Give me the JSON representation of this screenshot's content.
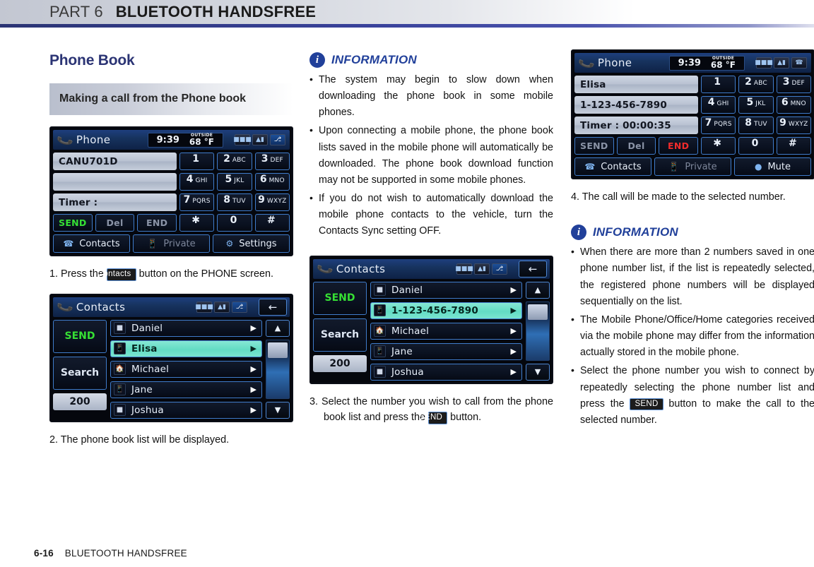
{
  "header": {
    "part": "PART 6",
    "title": "BLUETOOTH HANDSFREE"
  },
  "footer": {
    "page": "6-16",
    "label": "BLUETOOTH HANDSFREE"
  },
  "left": {
    "section_title": "Phone Book",
    "subsection_title": "Making a call from the Phone book",
    "step1_pre": "1. Press the ",
    "step1_chip": "Contacts",
    "step1_post": " button on the PHONE screen.",
    "step2": "2. The phone book list will be displayed.",
    "phone_screen": {
      "title": "Phone",
      "time": "9:39",
      "outside_label": "OUTSIDE",
      "temp": "68 °F",
      "field1": "CANU701D",
      "field2": "",
      "field3": "Timer :",
      "controls": [
        "SEND",
        "Del",
        "END"
      ],
      "keys": [
        {
          "num": "1",
          "abc": ""
        },
        {
          "num": "2",
          "abc": "ABC"
        },
        {
          "num": "3",
          "abc": "DEF"
        },
        {
          "num": "4",
          "abc": "GHI"
        },
        {
          "num": "5",
          "abc": "JKL"
        },
        {
          "num": "6",
          "abc": "MNO"
        },
        {
          "num": "7",
          "abc": "PQRS"
        },
        {
          "num": "8",
          "abc": "TUV"
        },
        {
          "num": "9",
          "abc": "WXYZ"
        },
        {
          "num": "✱",
          "abc": ""
        },
        {
          "num": "0",
          "abc": ""
        },
        {
          "num": "#",
          "abc": ""
        }
      ],
      "foot": [
        "Contacts",
        "Private",
        "Settings"
      ]
    },
    "contacts_screen": {
      "title": "Contacts",
      "send": "SEND",
      "search": "Search",
      "count": "200",
      "rows": [
        {
          "name": "Daniel",
          "icon": "office-icon",
          "selected": false
        },
        {
          "name": "Elisa",
          "icon": "mobile-icon",
          "selected": true
        },
        {
          "name": "Michael",
          "icon": "home-icon",
          "selected": false
        },
        {
          "name": "Jane",
          "icon": "mobile-icon",
          "selected": false
        },
        {
          "name": "Joshua",
          "icon": "office-icon",
          "selected": false
        }
      ]
    }
  },
  "middle": {
    "info_label": "INFORMATION",
    "info_items": [
      "The system may begin to slow down when downloading the phone book in some mobile phones.",
      "Upon connecting a mobile phone, the phone book lists saved in the mobile phone will automatically be downloaded. The phone book download function may not be supported in some mobile phones.",
      "If you do not wish to automatically download the mobile phone contacts to the vehicle, turn the Contacts Sync setting OFF."
    ],
    "step3_pre": "3. Select the number you wish to call from the phone book list and press the ",
    "step3_chip": "SEND",
    "step3_post": " button.",
    "contacts_screen": {
      "title": "Contacts",
      "send": "SEND",
      "search": "Search",
      "count": "200",
      "rows": [
        {
          "name": "Daniel",
          "icon": "office-icon",
          "selected": false
        },
        {
          "name": "1-123-456-7890",
          "icon": "mobile-icon",
          "selected": true
        },
        {
          "name": "Michael",
          "icon": "home-icon",
          "selected": false
        },
        {
          "name": "Jane",
          "icon": "mobile-icon",
          "selected": false
        },
        {
          "name": "Joshua",
          "icon": "office-icon",
          "selected": false
        }
      ]
    }
  },
  "right": {
    "phone_screen": {
      "title": "Phone",
      "time": "9:39",
      "outside_label": "OUTSIDE",
      "temp": "68 °F",
      "field1": "Elisa",
      "field2": "1-123-456-7890",
      "field3": "Timer : 00:00:35",
      "controls": [
        "SEND",
        "Del",
        "END"
      ],
      "keys": [
        {
          "num": "1",
          "abc": ""
        },
        {
          "num": "2",
          "abc": "ABC"
        },
        {
          "num": "3",
          "abc": "DEF"
        },
        {
          "num": "4",
          "abc": "GHI"
        },
        {
          "num": "5",
          "abc": "JKL"
        },
        {
          "num": "6",
          "abc": "MNO"
        },
        {
          "num": "7",
          "abc": "PQRS"
        },
        {
          "num": "8",
          "abc": "TUV"
        },
        {
          "num": "9",
          "abc": "WXYZ"
        },
        {
          "num": "✱",
          "abc": ""
        },
        {
          "num": "0",
          "abc": ""
        },
        {
          "num": "#",
          "abc": ""
        }
      ],
      "foot": [
        "Contacts",
        "Private",
        "Mute"
      ]
    },
    "step4": "4. The call will be made to the selected number.",
    "info_label": "INFORMATION",
    "info_items": [
      "When there are more than 2 numbers saved in one phone number list, if the list is repeatedly selected, the registered phone numbers will be displayed sequentially on the list.",
      "The Mobile Phone/Office/Home categories received via the mobile phone may differ from the information actually stored in the mobile phone."
    ],
    "info_last_pre": "Select the phone number you wish to connect by repeatedly selecting the phone number list and press the ",
    "info_last_chip": "SEND",
    "info_last_post": " button to make the call to the selected number."
  }
}
